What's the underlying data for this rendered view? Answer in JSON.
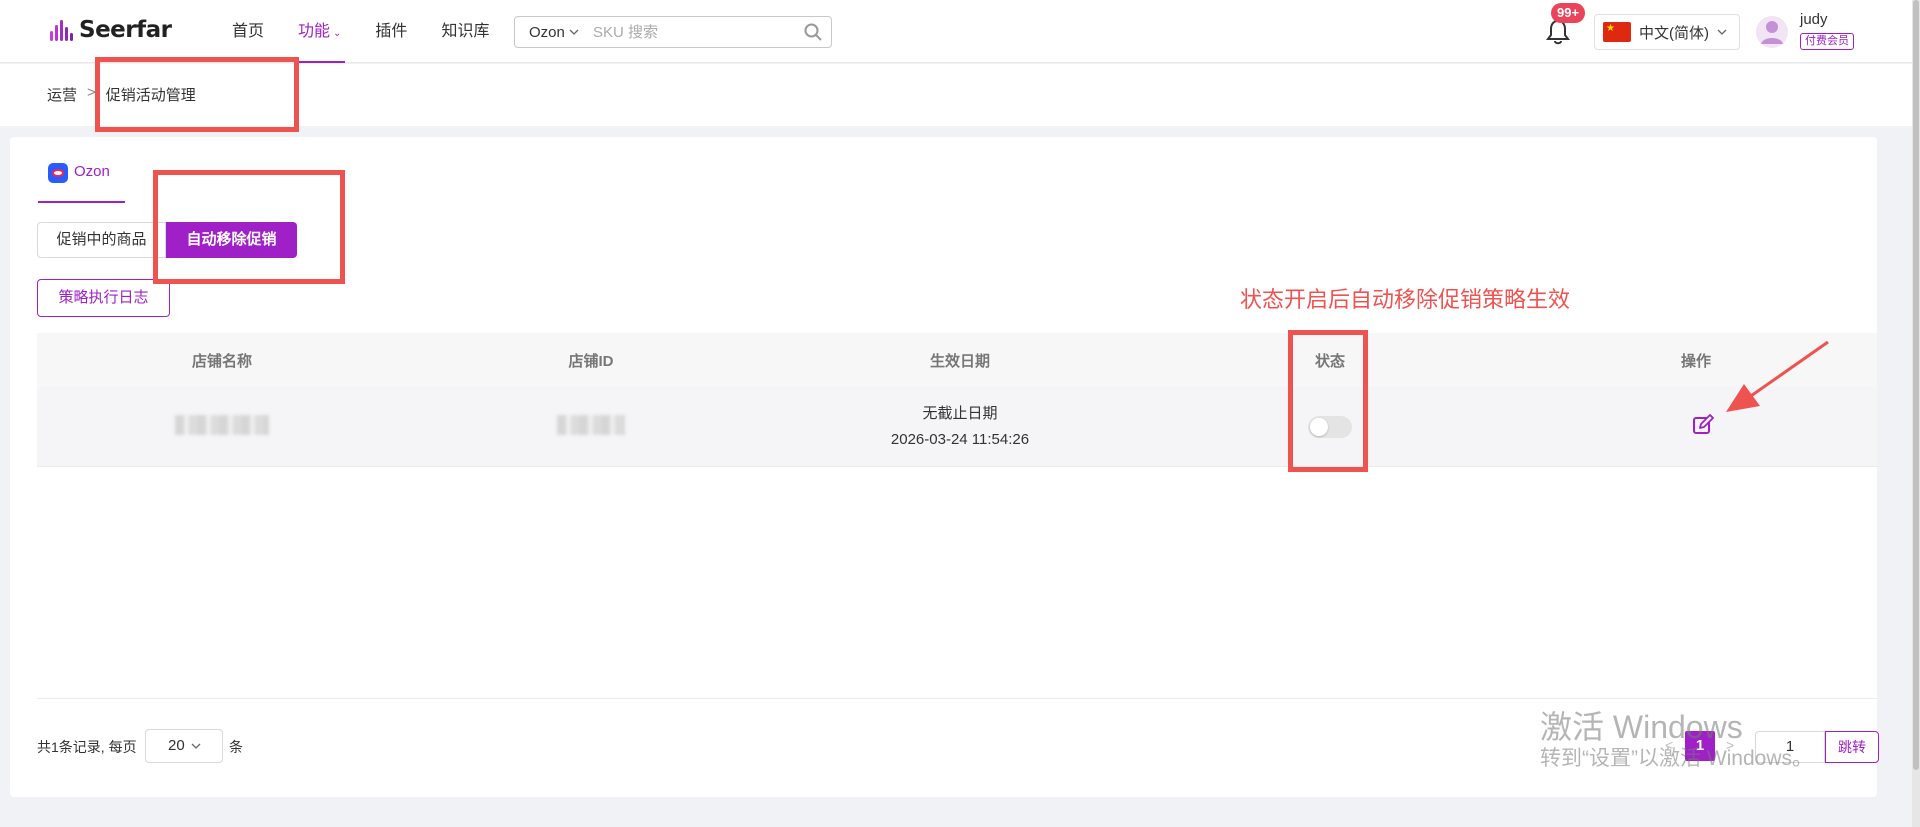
{
  "header": {
    "brand": "Seerfar",
    "nav": [
      {
        "label": "首页"
      },
      {
        "label": "功能",
        "active": true,
        "has_caret": true
      },
      {
        "label": "插件"
      },
      {
        "label": "知识库"
      }
    ],
    "search": {
      "platform": "Ozon",
      "placeholder": "SKU 搜索"
    },
    "notifications": "99+",
    "language": "中文(简体)",
    "user": {
      "name": "judy",
      "badge": "付费会员"
    }
  },
  "breadcrumb": {
    "parent": "运营",
    "separator": ">",
    "current": "促销活动管理"
  },
  "platform_tab": "Ozon",
  "sub_tabs": [
    {
      "label": "促销中的商品",
      "active": false
    },
    {
      "label": "自动移除促销",
      "active": true
    }
  ],
  "log_button": "策略执行日志",
  "annotation": "状态开启后自动移除促销策略生效",
  "table": {
    "columns": [
      "店铺名称",
      "店铺ID",
      "生效日期",
      "状态",
      "操作"
    ],
    "rows": [
      {
        "store_name": "",
        "store_id": "",
        "date_line1": "无截止日期",
        "date_line2": "2026-03-24 11:54:26",
        "status_on": false
      }
    ]
  },
  "pagination": {
    "total": "共1条记录, 每页",
    "page_size": "20",
    "unit": "条",
    "prev": "<",
    "current": "1",
    "next": ">",
    "jump_value": "1",
    "jump_label": "跳转"
  },
  "watermark": {
    "line1": "激活 Windows",
    "line2": "转到“设置”以激活 Windows。"
  },
  "colors": {
    "accent": "#a020c8",
    "annotation_red": "#ef5350",
    "badge_red": "#e94459"
  }
}
